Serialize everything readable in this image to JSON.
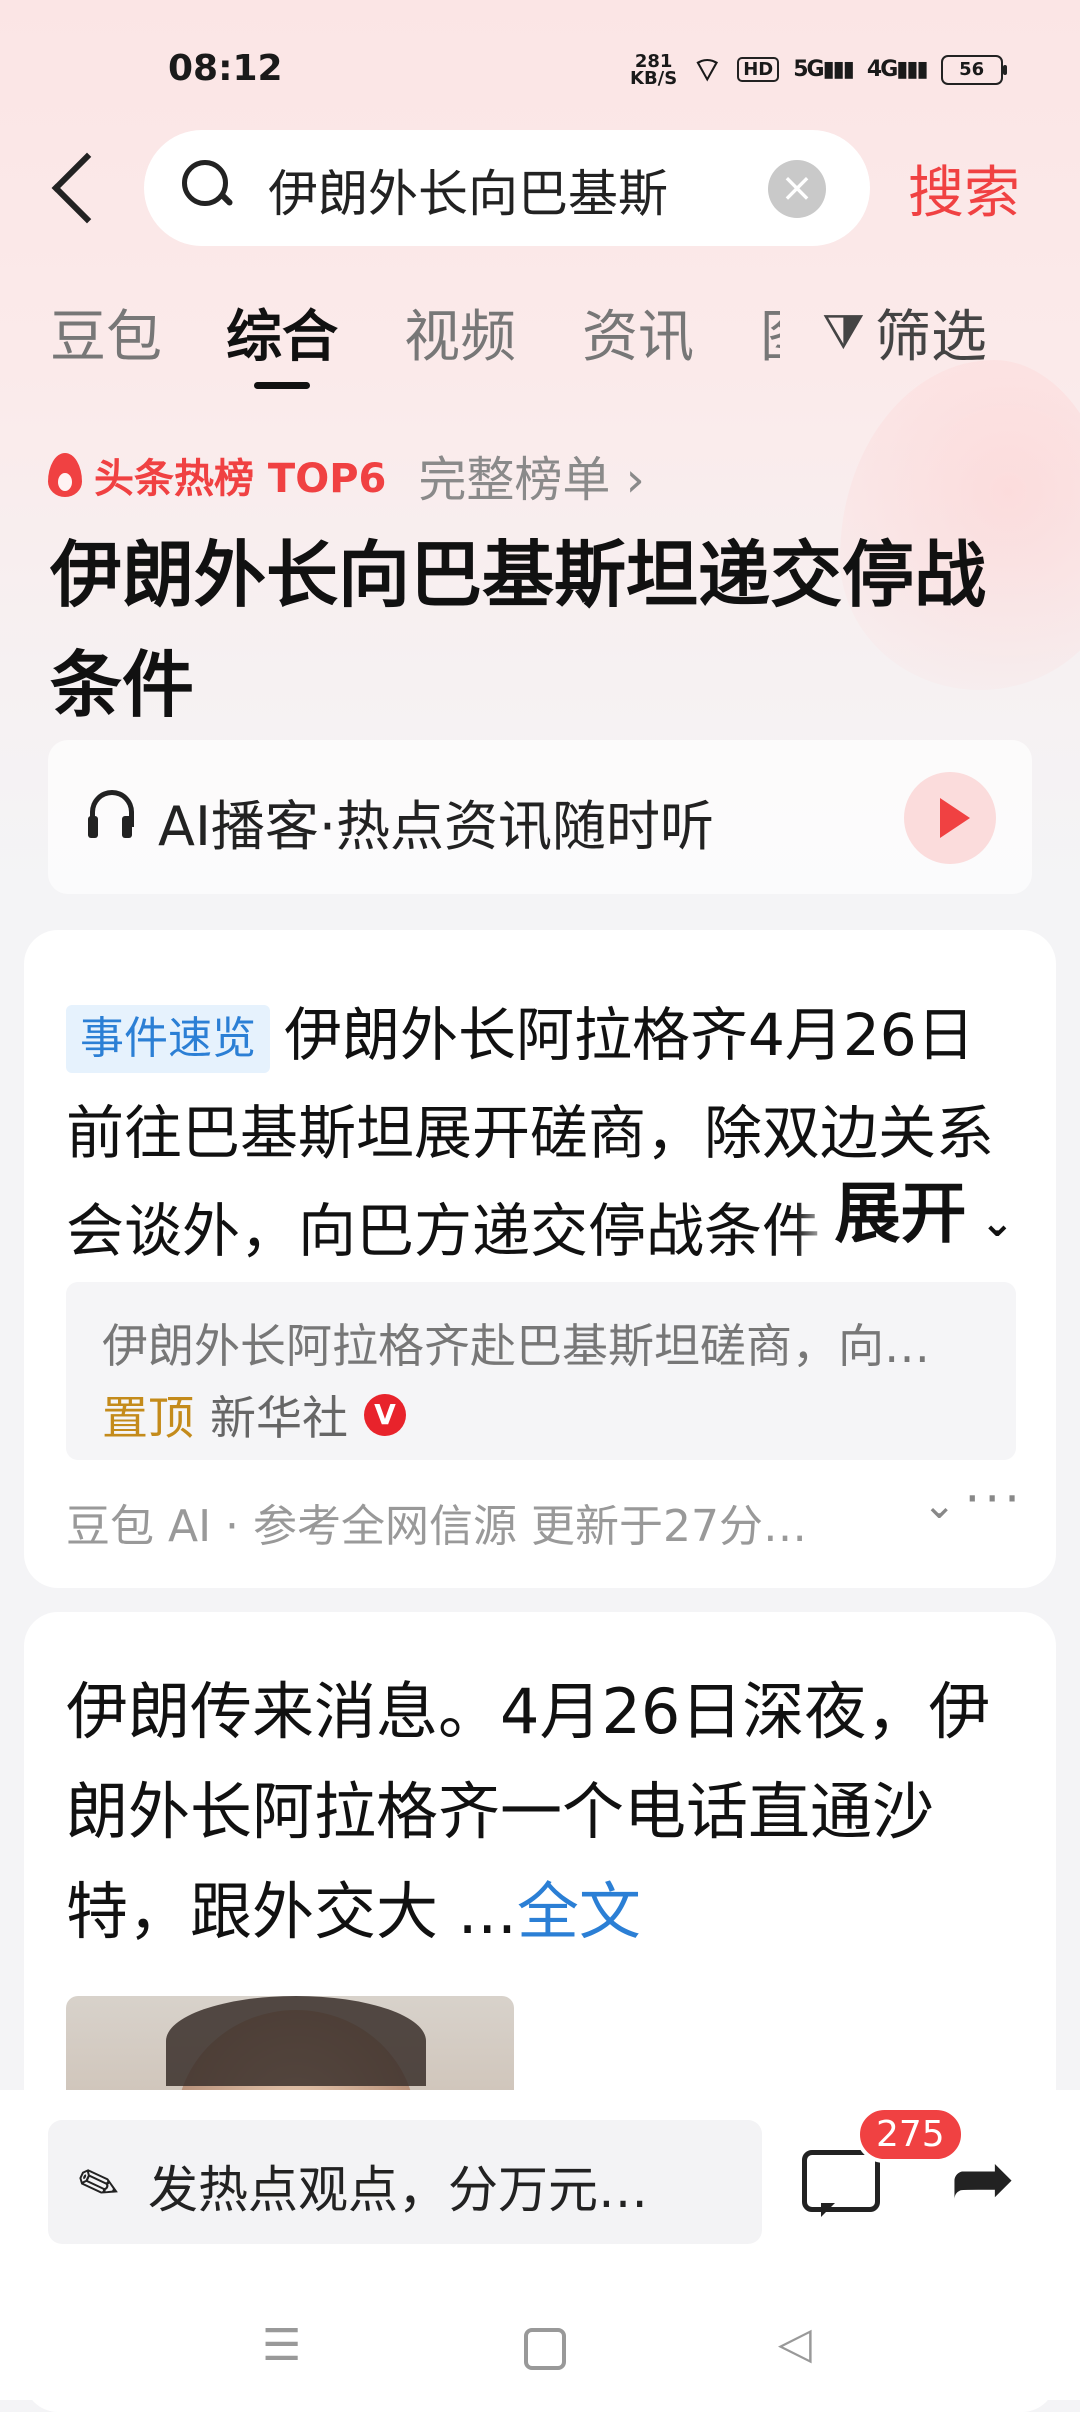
{
  "status_bar": {
    "time": "08:12",
    "net_speed_value": "281",
    "net_speed_unit": "KB/S",
    "hd_label": "HD",
    "sim1": "5G",
    "sim2": "4G",
    "battery": "56"
  },
  "search": {
    "query": "伊朗外长向巴基斯",
    "clear_icon": "close-icon",
    "button_label": "搜索"
  },
  "tabs": [
    {
      "label": "豆包",
      "active": false
    },
    {
      "label": "综合",
      "active": true
    },
    {
      "label": "视频",
      "active": false
    },
    {
      "label": "资讯",
      "active": false
    },
    {
      "label": "图",
      "active": false
    }
  ],
  "filter_label": "筛选",
  "hot_rank": {
    "label": "头条热榜 TOP6",
    "full_list": "完整榜单 ›"
  },
  "title": "伊朗外长向巴基斯坦递交停战条件",
  "podcast": {
    "label": "AI播客·热点资讯随时听"
  },
  "summary_card": {
    "tag": "事件速览",
    "text": "伊朗外长阿拉格齐4月26日前往巴基斯坦展开磋商，除双边关系会谈外，向巴方递交停战条件",
    "expand_label": "展开",
    "source_title": "伊朗外长阿拉格齐赴巴基斯坦磋商，向…",
    "pin_label": "置顶",
    "source_name": "新华社",
    "verified_mark": "V",
    "footer": "豆包 AI · 参考全网信源 更新于27分…"
  },
  "post_card": {
    "text": "伊朗传来消息。4月26日深夜，伊朗外长阿拉格齐一个电话直通沙特，跟外交大 ...",
    "full_text_link": "全文"
  },
  "bottom_bar": {
    "comment_placeholder": "发热点观点，分万元…",
    "comment_count": "275"
  }
}
